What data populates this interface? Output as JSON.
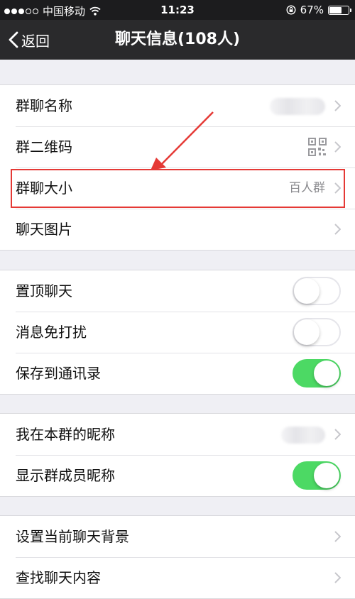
{
  "status_bar": {
    "carrier": "中国移动",
    "time": "11:23",
    "battery": "67%",
    "battery_level": 0.67
  },
  "nav": {
    "back_label": "返回",
    "title": "聊天信息(108人)"
  },
  "group1": {
    "name_label": "群聊名称",
    "qr_label": "群二维码",
    "size_label": "群聊大小",
    "size_value": "百人群",
    "images_label": "聊天图片"
  },
  "group2": {
    "pin_label": "置顶聊天",
    "pin_on": false,
    "mute_label": "消息免打扰",
    "mute_on": false,
    "save_label": "保存到通讯录",
    "save_on": true
  },
  "group3": {
    "nickname_label": "我在本群的昵称",
    "show_nicknames_label": "显示群成员昵称",
    "show_nicknames_on": true
  },
  "group4": {
    "background_label": "设置当前聊天背景",
    "search_label": "查找聊天内容"
  },
  "colors": {
    "toggle_on": "#4cd964",
    "annotation": "#e53935",
    "nav_bg": "#2a2a2c"
  }
}
